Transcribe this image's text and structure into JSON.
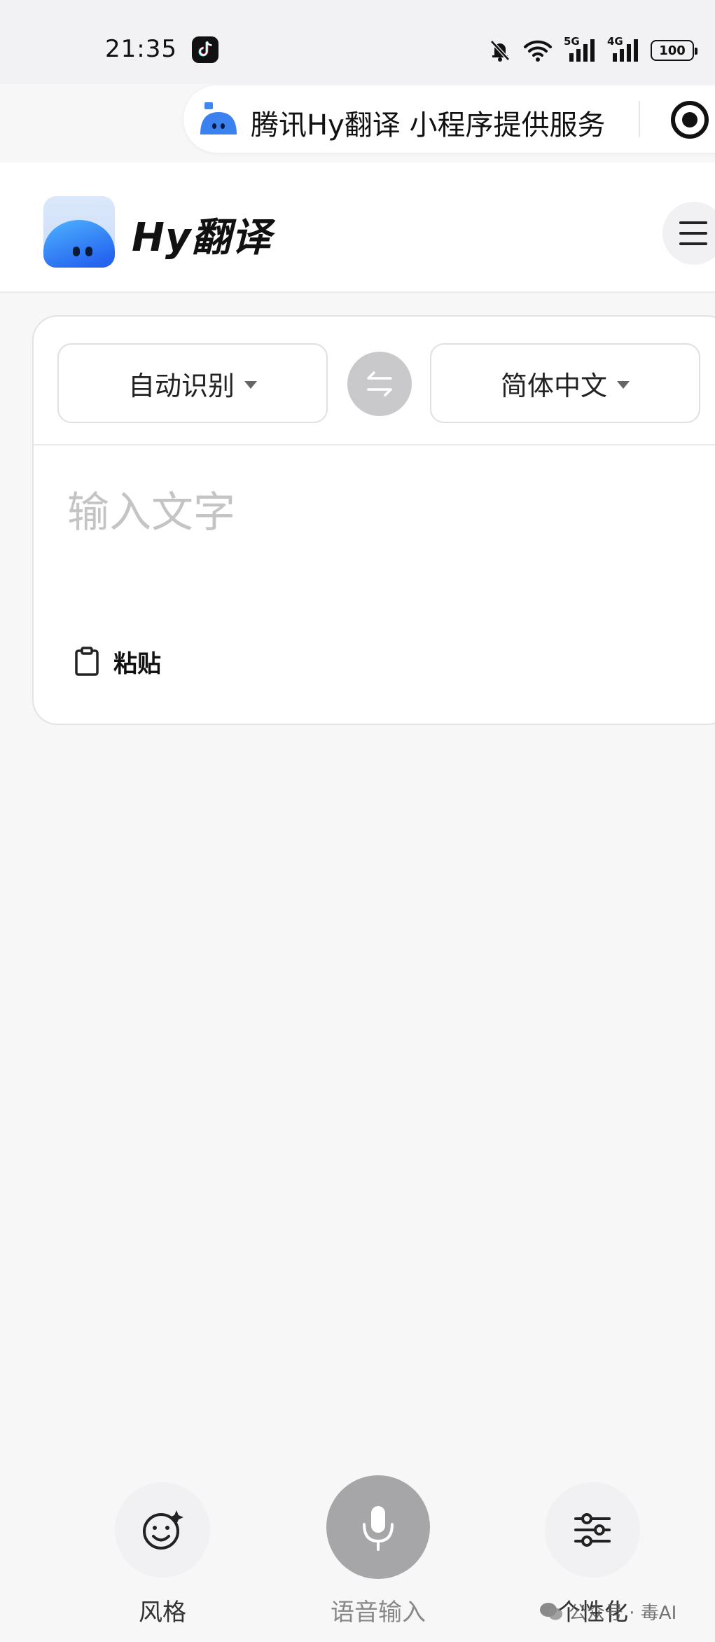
{
  "status_bar": {
    "time": "21:35",
    "app_icon": "tiktok-icon",
    "icons": [
      "mute-bell-icon",
      "wifi-icon",
      "signal-5g-icon",
      "signal-4g-icon"
    ],
    "signal_labels": [
      "5G",
      "4G"
    ],
    "battery": "100"
  },
  "mini_program": {
    "title": "腾讯Hy翻译 小程序提供服务",
    "logo_icon": "hy-mascot-icon",
    "close_icon": "target-icon"
  },
  "header": {
    "title": "Hy翻译",
    "logo_icon": "hy-app-logo-icon",
    "menu_icon": "hamburger-menu-icon"
  },
  "translator": {
    "source_language": "自动识别",
    "target_language": "简体中文",
    "swap_icon": "swap-arrows-icon",
    "input_placeholder": "输入文字",
    "input_value": "",
    "paste_label": "粘贴",
    "paste_icon": "clipboard-icon"
  },
  "bottom_bar": {
    "style_label": "风格",
    "style_icon": "smiley-sparkle-icon",
    "voice_label": "语音输入",
    "voice_icon": "microphone-icon",
    "settings_label": "个性化",
    "settings_icon": "sliders-icon"
  },
  "watermark": {
    "text": "公众号 · 毒AI",
    "icon": "wechat-icon"
  },
  "colors": {
    "accent_blue": "#2566f0",
    "placeholder_gray": "#c4c4c4",
    "voice_button_gray": "#a6a6a8"
  }
}
